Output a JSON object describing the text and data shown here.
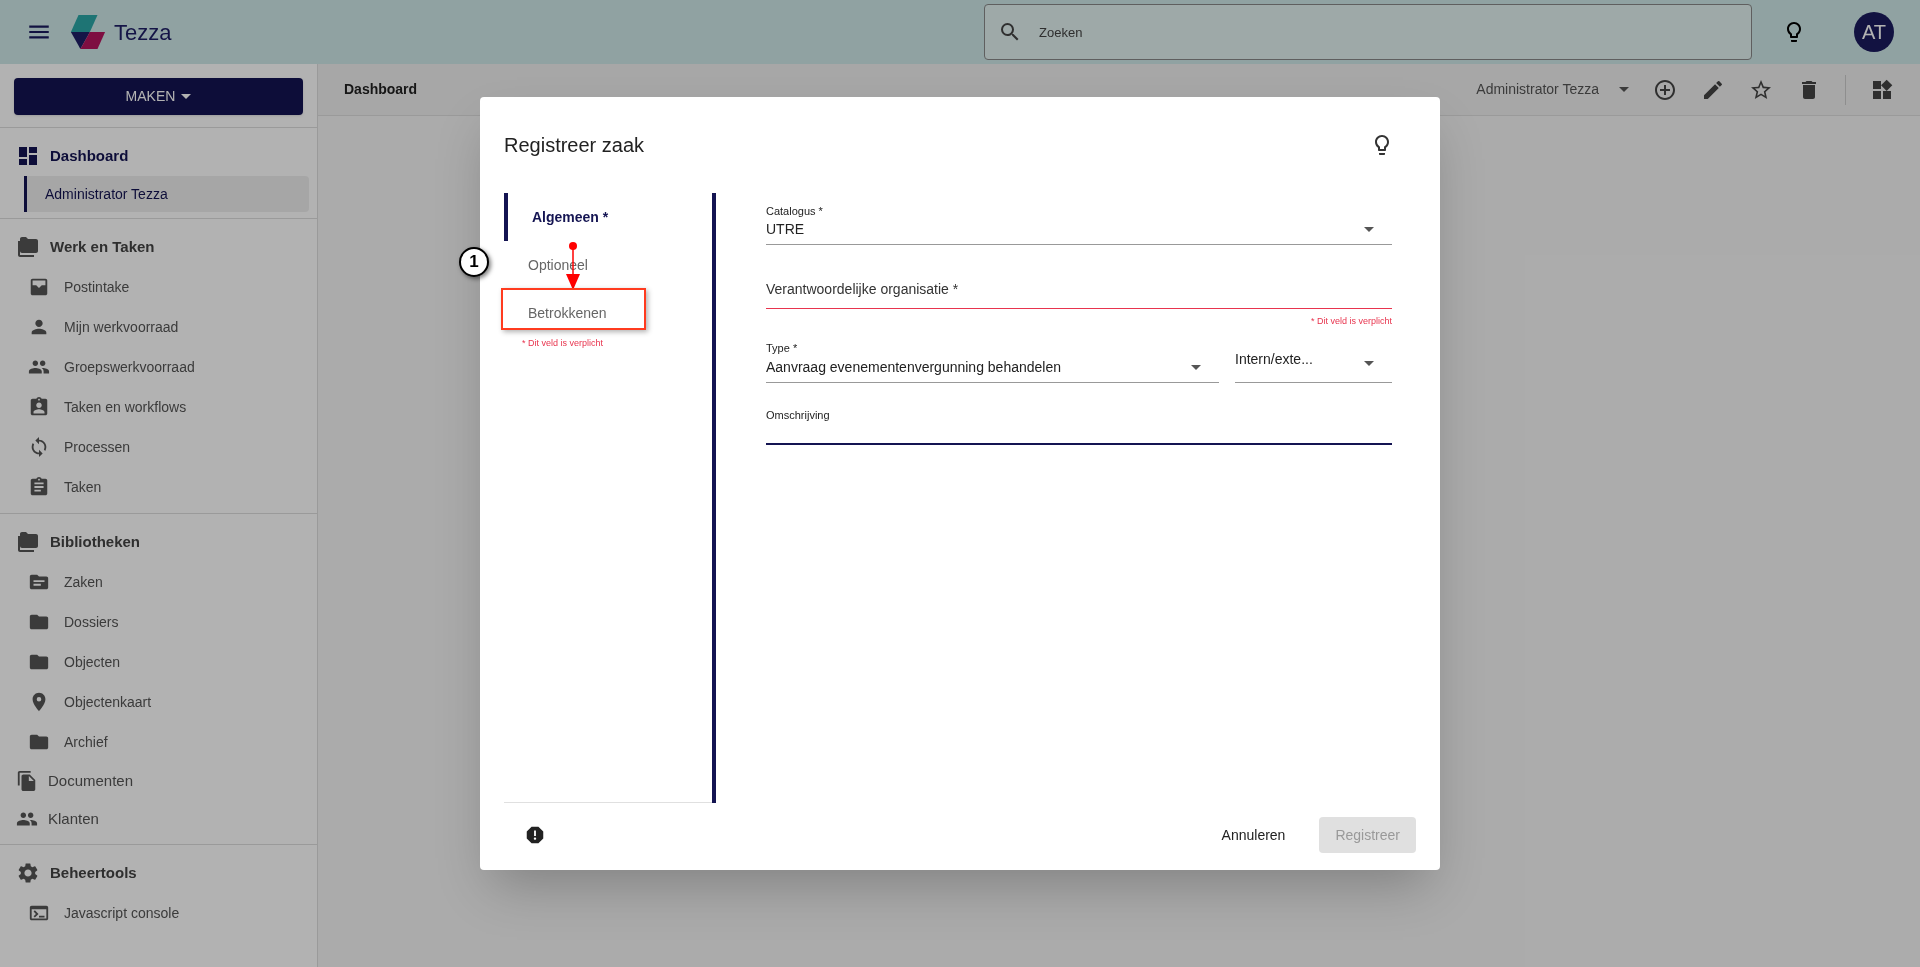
{
  "header": {
    "app_name": "Tezza",
    "search": {
      "placeholder": "Zoeken"
    },
    "avatar": "AT"
  },
  "sidebar": {
    "create_button": "MAKEN",
    "nav": [
      {
        "kind": "group",
        "label": "Dashboard",
        "selected": true,
        "children": [
          {
            "label": "Administrator Tezza",
            "selected": true
          }
        ]
      },
      {
        "kind": "group",
        "label": "Werk en Taken",
        "selected": false,
        "children": [
          {
            "label": "Postintake",
            "selected": false
          },
          {
            "label": "Mijn werkvoorraad",
            "selected": false
          },
          {
            "label": "Groepswerkvoorraad",
            "selected": false
          },
          {
            "label": "Taken en workflows",
            "selected": false
          },
          {
            "label": "Processen",
            "selected": false
          },
          {
            "label": "Taken",
            "selected": false
          }
        ]
      },
      {
        "kind": "group",
        "label": "Bibliotheken",
        "selected": false,
        "children": [
          {
            "label": "Zaken",
            "selected": false
          },
          {
            "label": "Dossiers",
            "selected": false
          },
          {
            "label": "Objecten",
            "selected": false
          },
          {
            "label": "Objectenkaart",
            "selected": false
          },
          {
            "label": "Archief",
            "selected": false
          }
        ]
      },
      {
        "kind": "link",
        "label": "Documenten",
        "selected": false
      },
      {
        "kind": "link",
        "label": "Klanten",
        "selected": false
      },
      {
        "kind": "group",
        "label": "Beheertools",
        "selected": false,
        "children": [
          {
            "label": "Javascript console",
            "selected": false
          }
        ]
      }
    ]
  },
  "toolbar": {
    "breadcrumb": "Dashboard",
    "user_select": "Administrator Tezza"
  },
  "dialog": {
    "title": "Registreer zaak",
    "steps": [
      {
        "label": "Algemeen *",
        "selected": true
      },
      {
        "label": "Optioneel",
        "selected": false
      },
      {
        "label": "Betrokkenen",
        "selected": false,
        "error": "* Dit veld is verplicht"
      }
    ],
    "fields": [
      {
        "kind": "select",
        "label": "Catalogus *",
        "value": "UTRE"
      },
      {
        "kind": "input",
        "placeholder": "Verantwoordelijke organisatie *",
        "invalid": true,
        "error": "* Dit veld is verplicht"
      },
      {
        "kind": "select_pair",
        "label": "Type *",
        "value": "Aanvraag evenementenvergunning behandelen",
        "second_value": "Intern/exte..."
      },
      {
        "kind": "input",
        "label": "Omschrijving",
        "focused": true
      }
    ],
    "buttons": [
      {
        "label": "Annuleren",
        "disabled": false
      },
      {
        "label": "Registreer",
        "disabled": true
      }
    ]
  },
  "annotation": {
    "badge": "1"
  }
}
